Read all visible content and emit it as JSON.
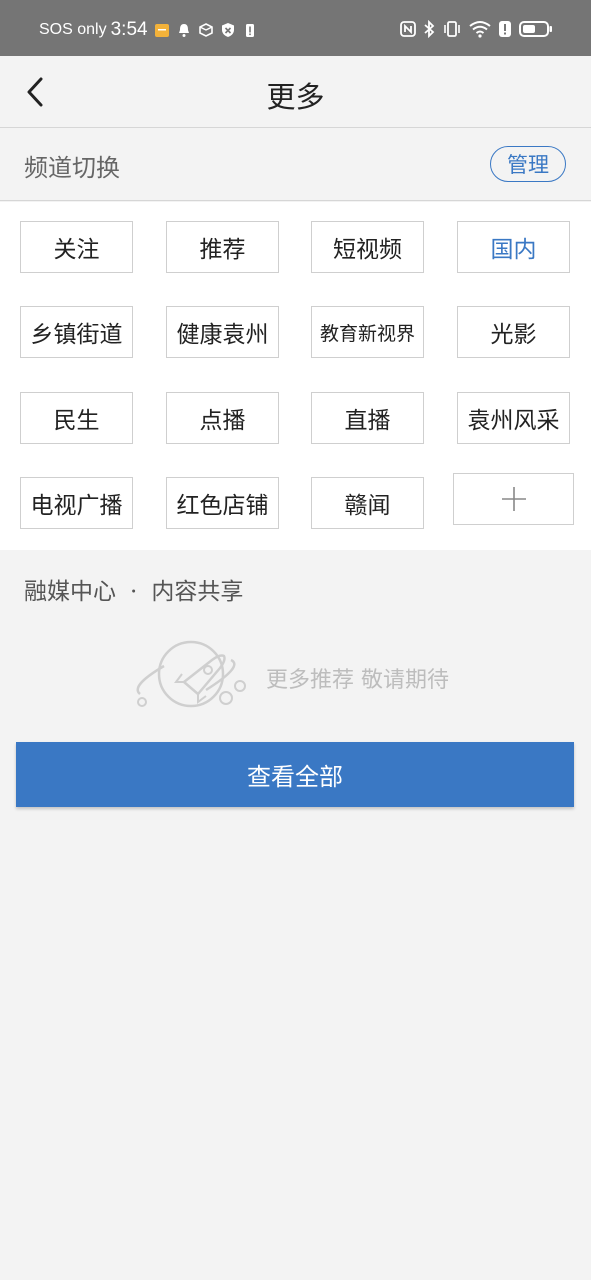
{
  "status_bar": {
    "carrier": "SOS only",
    "time": "3:54"
  },
  "header": {
    "title": "更多"
  },
  "channel": {
    "title": "频道切换",
    "manage_label": "管理",
    "items": [
      {
        "label": "关注"
      },
      {
        "label": "推荐"
      },
      {
        "label": "短视频"
      },
      {
        "label": "国内",
        "active": true
      },
      {
        "label": "乡镇街道"
      },
      {
        "label": "健康袁州"
      },
      {
        "label": "教育新视界"
      },
      {
        "label": "光影"
      },
      {
        "label": "民生"
      },
      {
        "label": "点播"
      },
      {
        "label": "直播"
      },
      {
        "label": "袁州风采"
      },
      {
        "label": "电视广播"
      },
      {
        "label": "红色店铺"
      },
      {
        "label": "赣闻"
      }
    ],
    "add_symbol": "+"
  },
  "media": {
    "title_left": "融媒中心",
    "separator": "·",
    "title_right": "内容共享",
    "empty_text": "更多推荐 敬请期待",
    "view_all_label": "查看全部"
  },
  "colors": {
    "accent": "#3a78c4",
    "status_bar_bg": "#757575",
    "page_bg": "#f3f3f3"
  }
}
